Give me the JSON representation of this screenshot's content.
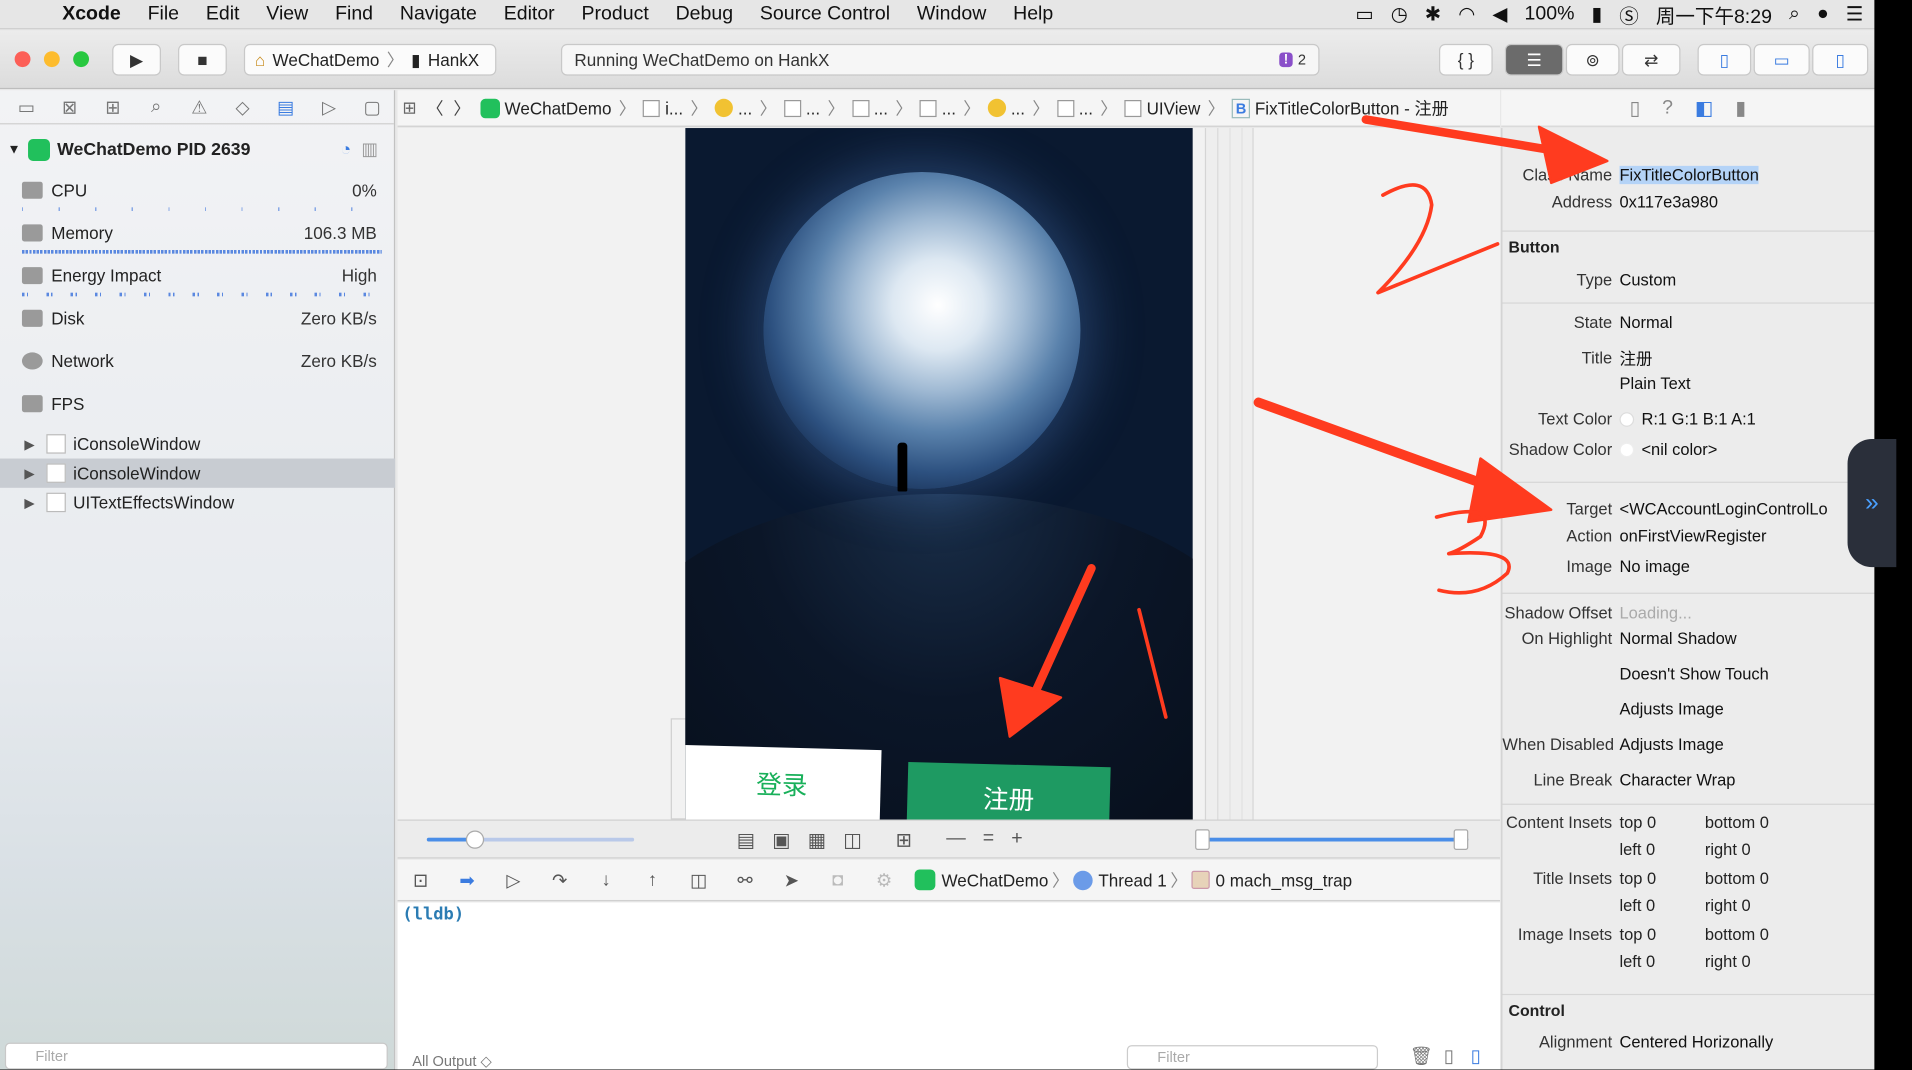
{
  "menubar": {
    "app": "Xcode",
    "items": [
      "File",
      "Edit",
      "View",
      "Find",
      "Navigate",
      "Editor",
      "Product",
      "Debug",
      "Source Control",
      "Window",
      "Help"
    ],
    "battery": "100%",
    "clock": "周一下午8:29"
  },
  "toolbar": {
    "scheme": "WeChatDemo",
    "device": "HankX",
    "status": "Running WeChatDemo on HankX",
    "warning_count": "2"
  },
  "navigator": {
    "process": "WeChatDemo PID 2639",
    "gauges": [
      {
        "label": "CPU",
        "value": "0%"
      },
      {
        "label": "Memory",
        "value": "106.3 MB"
      },
      {
        "label": "Energy Impact",
        "value": "High"
      },
      {
        "label": "Disk",
        "value": "Zero KB/s"
      },
      {
        "label": "Network",
        "value": "Zero KB/s"
      },
      {
        "label": "FPS",
        "value": ""
      }
    ],
    "tree": [
      "iConsoleWindow",
      "iConsoleWindow",
      "UITextEffectsWindow"
    ],
    "filter_placeholder": "Filter"
  },
  "jumpbar": {
    "app": "WeChatDemo",
    "crumbs": [
      "i...",
      "...",
      "...",
      "...",
      "...",
      "...",
      "..."
    ],
    "uiview": "UIView",
    "selected": "FixTitleColorButton - 注册"
  },
  "canvas": {
    "login_label": "登录",
    "register_label": "注册"
  },
  "debugbar": {
    "app": "WeChatDemo",
    "thread": "Thread 1",
    "frame": "0 mach_msg_trap"
  },
  "console": {
    "prompt": "(lldb)",
    "output_selector": "All Output ◇",
    "filter_placeholder": "Filter"
  },
  "inspector": {
    "class_name_label": "Class Name",
    "class_name_value": "FixTitleColorButton",
    "address_label": "Address",
    "address_value": "0x117e3a980",
    "section_button": "Button",
    "type_label": "Type",
    "type_value": "Custom",
    "state_label": "State",
    "state_value": "Normal",
    "title_label": "Title",
    "title_value": "注册",
    "title_kind": "Plain Text",
    "text_color_label": "Text Color",
    "text_color_value": "R:1 G:1 B:1 A:1",
    "shadow_color_label": "Shadow Color",
    "shadow_color_value": "<nil color>",
    "target_label": "Target",
    "target_value": "<WCAccountLoginControlLo",
    "action_label": "Action",
    "action_value": "onFirstViewRegister",
    "image_label": "Image",
    "image_value": "No image",
    "shadow_offset_label": "Shadow Offset",
    "shadow_offset_value": "Loading...",
    "on_highlight_label": "On Highlight",
    "on_highlight_value": "Normal Shadow",
    "touch_value": "Doesn't Show Touch",
    "adjusts_value": "Adjusts Image",
    "when_disabled_label": "When Disabled",
    "when_disabled_value": "Adjusts Image",
    "line_break_label": "Line Break",
    "line_break_value": "Character Wrap",
    "content_insets_label": "Content Insets",
    "title_insets_label": "Title Insets",
    "image_insets_label": "Image Insets",
    "inset_top": "top 0",
    "inset_bottom": "bottom 0",
    "inset_left": "left 0",
    "inset_right": "right 0",
    "section_control": "Control",
    "alignment_label": "Alignment",
    "alignment_value": "Centered Horizonally"
  },
  "annotations": {
    "n1": "1",
    "n2": "2",
    "n3": "3"
  },
  "colors": {
    "accent": "#3b7ce0",
    "arrow": "#ff3b1f",
    "wechat_green": "#19b05a"
  }
}
